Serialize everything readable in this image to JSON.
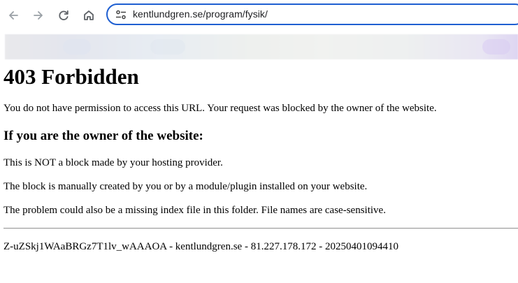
{
  "browser": {
    "address": "kentlundgren.se/program/fysik/",
    "icons": {
      "back": "arrow-left-icon",
      "forward": "arrow-right-icon",
      "reload": "reload-icon",
      "home": "home-icon",
      "site_info": "tune-icon"
    }
  },
  "page": {
    "heading": "403 Forbidden",
    "intro": "You do not have permission to access this URL. Your request was blocked by the owner of the website.",
    "owner_heading": "If you are the owner of the website:",
    "owner_lines": [
      "This is NOT a block made by your hosting provider.",
      "The block is manually created by you or by a module/plugin installed on your website.",
      "The problem could also be a missing index file in this folder. File names are case-sensitive."
    ],
    "footer": "Z-uZSkj1WAaBRGz7T1lv_wAAAOA - kentlundgren.se - 81.227.178.172 - 20250401094410"
  },
  "colors": {
    "omnibox_border": "#1f5fd1",
    "icon_gray": "#5f6368",
    "text": "#000000"
  }
}
